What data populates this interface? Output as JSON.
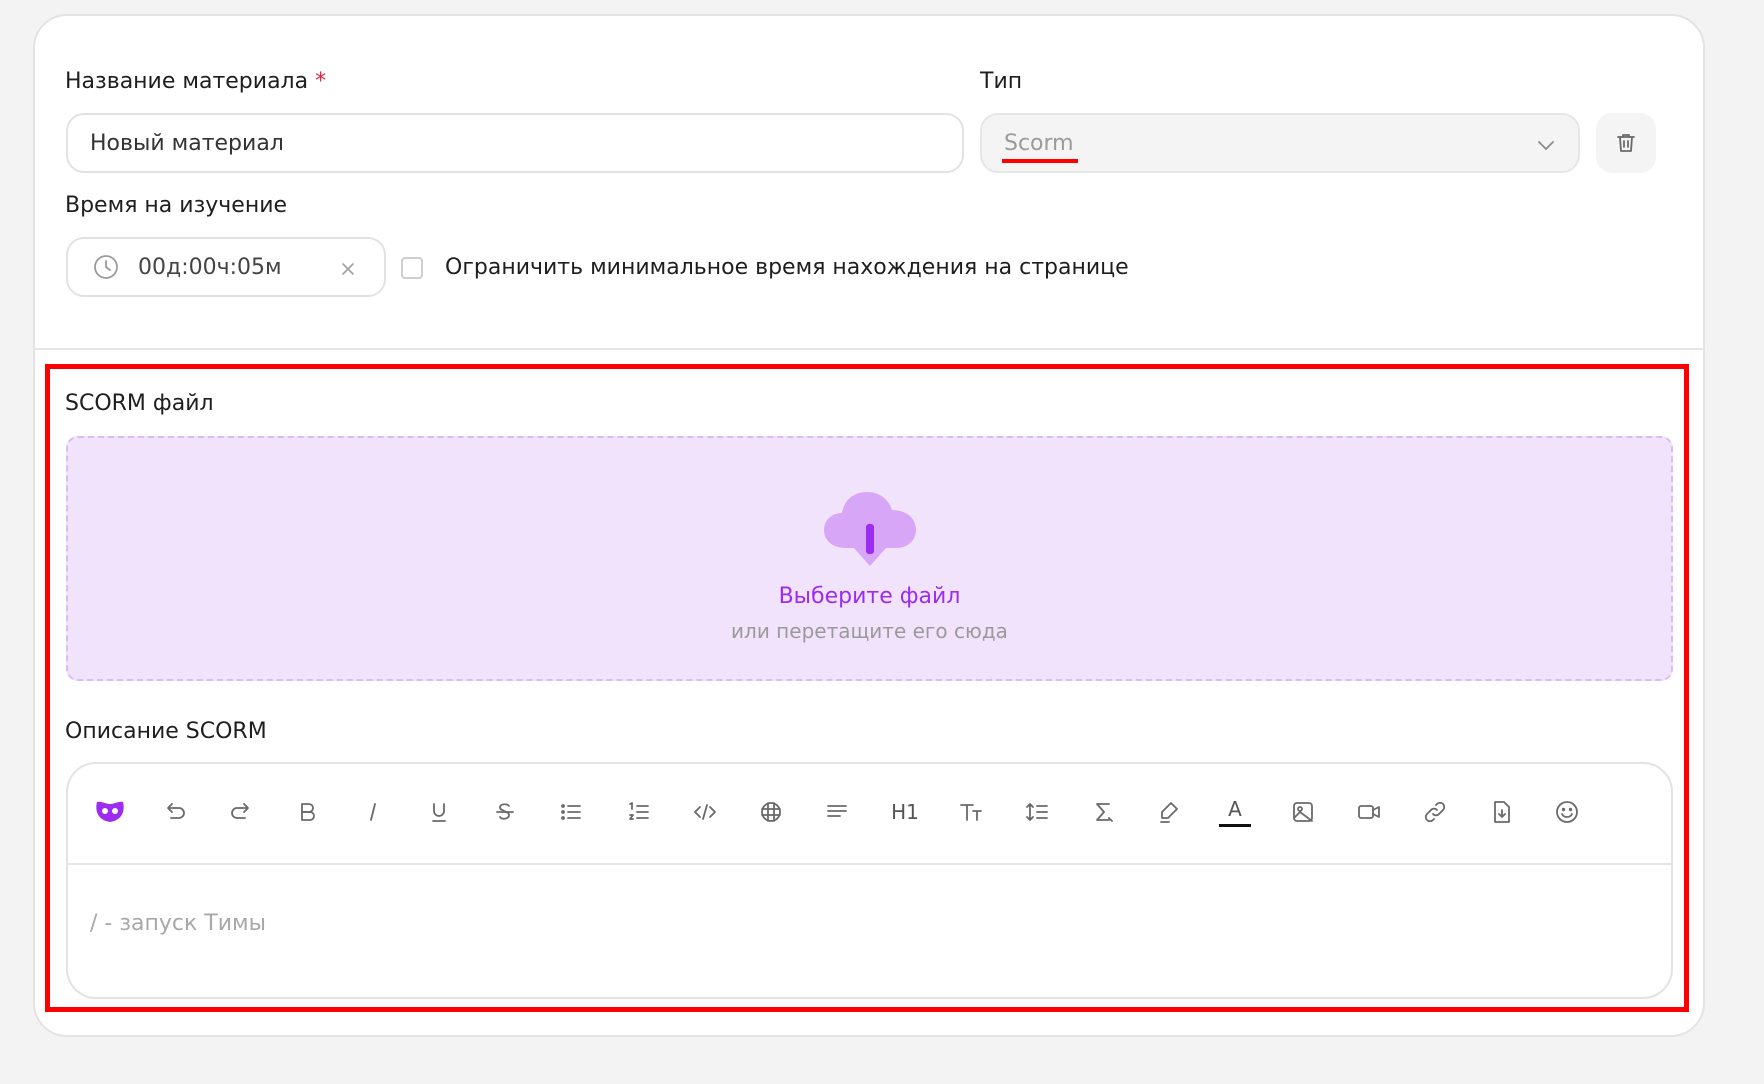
{
  "form": {
    "material_name_label": "Название материала",
    "required_mark": "*",
    "material_name_value": "Новый материал",
    "type_label": "Тип",
    "type_value": "Scorm",
    "time_label": "Время на изучение",
    "time_value": "00д:00ч:05м",
    "limit_checkbox_label": "Ограничить минимальное время нахождения на странице",
    "limit_checkbox_checked": false
  },
  "scorm": {
    "file_label": "SCORM файл",
    "choose_file": "Выберите файл",
    "drag_hint": "или перетащите его сюда",
    "description_label": "Описание SCORM",
    "editor_placeholder": "/ - запуск Тимы",
    "toolbar": [
      "tima-logo-icon",
      "undo-icon",
      "redo-icon",
      "bold-icon",
      "italic-icon",
      "underline-icon",
      "strikethrough-icon",
      "bullet-list-icon",
      "numbered-list-icon",
      "code-icon",
      "table-icon",
      "align-icon",
      "heading-icon",
      "font-size-icon",
      "line-height-icon",
      "clear-format-icon",
      "highlight-icon",
      "text-color-icon",
      "image-icon",
      "video-icon",
      "link-icon",
      "file-icon",
      "emoji-icon"
    ],
    "heading_label": "H1",
    "text_color_label": "A"
  },
  "colors": {
    "accent": "#9b2cf0",
    "dropzone_bg": "#f2e3fd",
    "highlight": "#ff0000",
    "required": "#e5233a"
  }
}
